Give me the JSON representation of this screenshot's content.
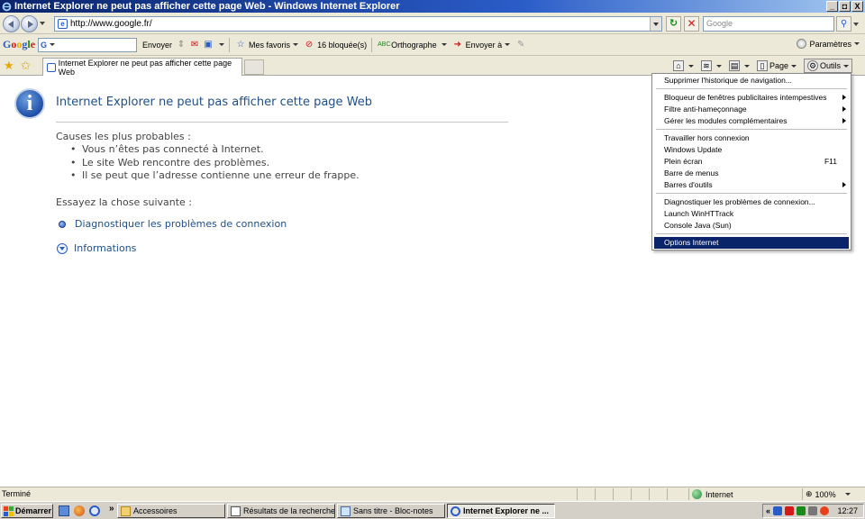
{
  "window": {
    "title": "Internet Explorer ne peut pas afficher cette page Web - Windows Internet Explorer",
    "buttons": [
      "_",
      "◘",
      "X"
    ]
  },
  "address_bar": {
    "url": "http://www.google.fr/",
    "search_placeholder": "Google"
  },
  "google_toolbar": {
    "logo_letters": [
      "G",
      "o",
      "o",
      "g",
      "l",
      "e"
    ],
    "search_icon_letter": "G",
    "items": {
      "send": "Envoyer",
      "favorites": "Mes favoris",
      "blocked": "16 bloquée(s)",
      "spelling": "Orthographe",
      "send_to": "Envoyer à",
      "settings": "Paramètres"
    },
    "icons": {
      "spelling": "ABC",
      "favorites": "☆"
    }
  },
  "tabs": [
    {
      "label": "Internet Explorer ne peut pas afficher cette page Web",
      "active": true
    }
  ],
  "command_bar": {
    "page": "Page",
    "tools": "Outils"
  },
  "error_page": {
    "title": "Internet Explorer ne peut pas afficher cette page Web",
    "causes_heading": "Causes les plus probables :",
    "causes": [
      "Vous n’êtes pas connecté à Internet.",
      "Le site Web rencontre des problèmes.",
      "Il se peut que l’adresse contienne une erreur de frappe."
    ],
    "try_heading": "Essayez la chose suivante :",
    "diagnose_link": "Diagnostiquer les problèmes de connexion",
    "more_info_link": "Informations"
  },
  "tools_menu": {
    "items": [
      {
        "label": "Supprimer l'historique de navigation...",
        "submenu": false,
        "shortcut": ""
      },
      {
        "label": "Bloqueur de fenêtres publicitaires intempestives",
        "submenu": true,
        "shortcut": ""
      },
      {
        "label": "Filtre anti-hameçonnage",
        "submenu": true,
        "shortcut": ""
      },
      {
        "label": "Gérer les modules complémentaires",
        "submenu": true,
        "shortcut": ""
      },
      {
        "label": "Travailler hors connexion",
        "submenu": false,
        "shortcut": ""
      },
      {
        "label": "Windows Update",
        "submenu": false,
        "shortcut": ""
      },
      {
        "label": "Plein écran",
        "submenu": false,
        "shortcut": "F11"
      },
      {
        "label": "Barre de menus",
        "submenu": false,
        "shortcut": ""
      },
      {
        "label": "Barres d'outils",
        "submenu": true,
        "shortcut": ""
      },
      {
        "label": "Diagnostiquer les problèmes de connexion...",
        "submenu": false,
        "shortcut": ""
      },
      {
        "label": "Launch WinHTTrack",
        "submenu": false,
        "shortcut": ""
      },
      {
        "label": "Console Java (Sun)",
        "submenu": false,
        "shortcut": ""
      },
      {
        "label": "Options Internet",
        "submenu": false,
        "shortcut": "",
        "highlighted": true
      }
    ]
  },
  "status_bar": {
    "status": "Terminé",
    "zone": "Internet",
    "zoom": "100%"
  },
  "taskbar": {
    "start": "Démarrer",
    "quick_launch_more": "»",
    "tray_expand": "«",
    "buttons": [
      {
        "label": "Accessoires",
        "active": false
      },
      {
        "label": "Résultats de la recherche",
        "active": false
      },
      {
        "label": "Sans titre - Bloc-notes",
        "active": false
      },
      {
        "label": "Internet Explorer ne ...",
        "active": true
      }
    ],
    "clock": "12:27"
  },
  "colors": {
    "title_link": "#1f4f8a",
    "menu_highlight": "#0a246a",
    "chrome": "#ece9d8"
  }
}
